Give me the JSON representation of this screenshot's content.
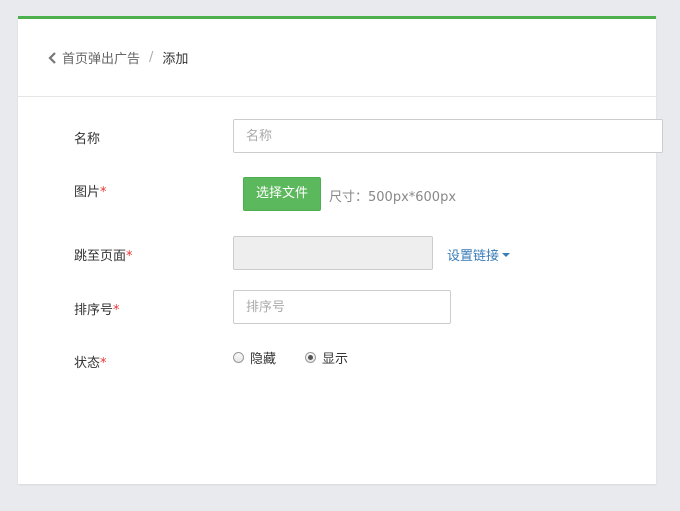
{
  "breadcrumb": {
    "back_label": "首页弹出广告",
    "separator": "/",
    "current": "添加"
  },
  "form": {
    "name": {
      "label": "名称",
      "placeholder": "名称",
      "value": ""
    },
    "image": {
      "label": "图片",
      "required_mark": "*",
      "button": "选择文件",
      "hint": "尺寸：500px*600px"
    },
    "target": {
      "label": "跳至页面",
      "required_mark": "*",
      "value": "",
      "link": "设置链接"
    },
    "sort": {
      "label": "排序号",
      "required_mark": "*",
      "placeholder": "排序号",
      "value": ""
    },
    "status": {
      "label": "状态",
      "required_mark": "*",
      "options": [
        {
          "label": "隐藏",
          "checked": false
        },
        {
          "label": "显示",
          "checked": true
        }
      ]
    }
  },
  "colors": {
    "accent": "#4cb04c",
    "button": "#5cb85c",
    "link": "#3a7cb8",
    "required": "#ee3333"
  },
  "icons": {
    "back": "chevron-left-icon",
    "dropdown": "caret-down-icon"
  }
}
